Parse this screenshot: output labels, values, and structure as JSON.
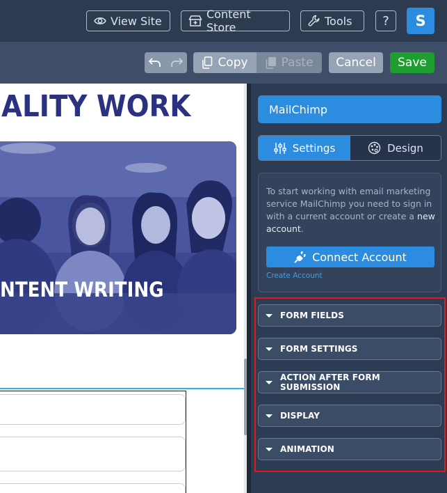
{
  "topbar": {
    "view_site_label": "View Site",
    "content_store_label": "Content Store",
    "tools_label": "Tools",
    "help_label": "?",
    "avatar_initial": "S"
  },
  "toolbar": {
    "copy_label": "Copy",
    "paste_label": "Paste",
    "cancel_label": "Cancel",
    "save_label": "Save"
  },
  "canvas": {
    "headline": "ALITY WORK",
    "hero_caption": "NTENT WRITING"
  },
  "panel": {
    "title": "MailChimp",
    "tabs": [
      {
        "label": "Settings",
        "active": true
      },
      {
        "label": "Design",
        "active": false
      }
    ],
    "info_text_before": "To start working with email marketing service MailChimp you need to sign in with a current account or create a ",
    "info_text_bold": "new account",
    "info_text_after": ".",
    "connect_label": "Connect Account",
    "create_link": "Create Account",
    "sections": [
      {
        "label": "FORM FIELDS"
      },
      {
        "label": "FORM SETTINGS"
      },
      {
        "label": "ACTION AFTER FORM SUBMISSION"
      },
      {
        "label": "DISPLAY"
      },
      {
        "label": "ANIMATION"
      }
    ]
  },
  "colors": {
    "accent": "#2c8de0",
    "save": "#1e9e2f",
    "highlight": "#e01b1b",
    "headline": "#2a3280",
    "selection": "#2bb3ea"
  }
}
